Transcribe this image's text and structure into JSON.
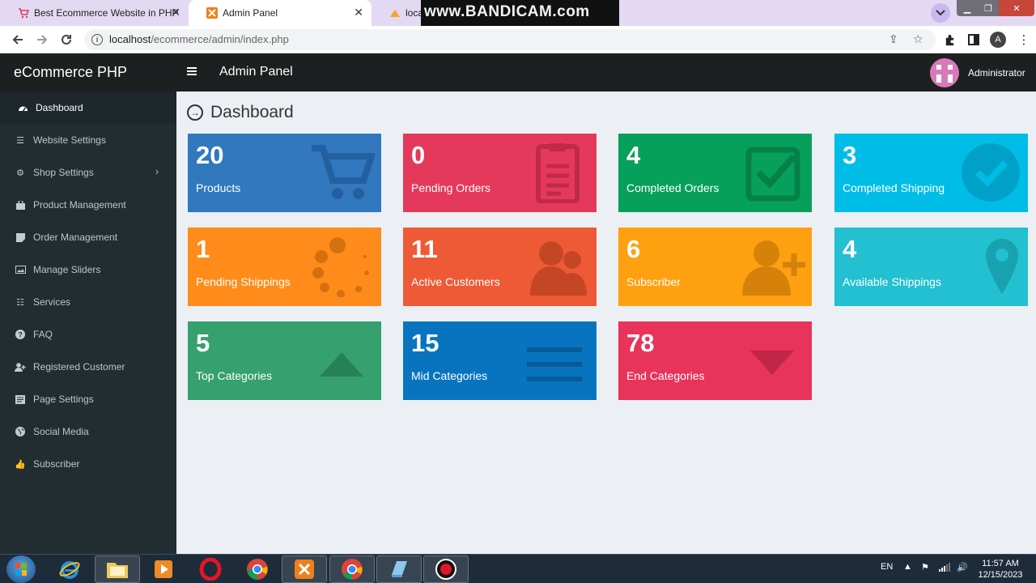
{
  "browser": {
    "tabs": [
      {
        "title": "Best Ecommerce Website in PHP",
        "active": false
      },
      {
        "title": "Admin Panel",
        "active": true
      },
      {
        "title": "localh",
        "active": false
      }
    ],
    "url_host": "localhost",
    "url_path": "/ecommerce/admin/index.php",
    "profile_initial": "A",
    "watermark": "www.BANDICAM.com"
  },
  "header": {
    "brand": "eCommerce PHP",
    "title": "Admin Panel",
    "user": "Administrator"
  },
  "sidebar": {
    "items": [
      {
        "label": "Dashboard",
        "icon": "dashboard-icon",
        "active": true
      },
      {
        "label": "Website Settings",
        "icon": "sliders-icon"
      },
      {
        "label": "Shop Settings",
        "icon": "cogs-icon",
        "has_submenu": true
      },
      {
        "label": "Product Management",
        "icon": "shopping-bag-icon"
      },
      {
        "label": "Order Management",
        "icon": "sticky-note-icon"
      },
      {
        "label": "Manage Sliders",
        "icon": "image-icon"
      },
      {
        "label": "Services",
        "icon": "list-icon"
      },
      {
        "label": "FAQ",
        "icon": "question-circle-icon"
      },
      {
        "label": "Registered Customer",
        "icon": "user-plus-icon"
      },
      {
        "label": "Page Settings",
        "icon": "file-icon"
      },
      {
        "label": "Social Media",
        "icon": "globe-icon"
      },
      {
        "label": "Subscriber",
        "icon": "thumbs-up-icon"
      }
    ]
  },
  "page": {
    "title": "Dashboard"
  },
  "cards": [
    {
      "value": "20",
      "label": "Products",
      "color": "#3178bf",
      "icon": "cart-icon"
    },
    {
      "value": "0",
      "label": "Pending Orders",
      "color": "#e5395b",
      "icon": "clipboard-icon"
    },
    {
      "value": "4",
      "label": "Completed Orders",
      "color": "#07a05a",
      "icon": "check-square-icon"
    },
    {
      "value": "3",
      "label": "Completed Shipping",
      "color": "#00bde8",
      "icon": "check-circle-icon"
    },
    {
      "value": "1",
      "label": "Pending Shippings",
      "color": "#ff8c1a",
      "icon": "spinner-icon"
    },
    {
      "value": "11",
      "label": "Active Customers",
      "color": "#ef5a36",
      "icon": "users-icon"
    },
    {
      "value": "6",
      "label": "Subscriber",
      "color": "#ffa010",
      "icon": "user-plus-icon"
    },
    {
      "value": "4",
      "label": "Available Shippings",
      "color": "#22c0d0",
      "icon": "map-marker-icon"
    },
    {
      "value": "5",
      "label": "Top Categories",
      "color": "#36a06e",
      "icon": "caret-up-icon"
    },
    {
      "value": "15",
      "label": "Mid Categories",
      "color": "#0874c0",
      "icon": "bars-icon"
    },
    {
      "value": "78",
      "label": "End Categories",
      "color": "#e8335a",
      "icon": "caret-down-icon"
    }
  ],
  "taskbar": {
    "lang": "EN",
    "time": "11:57 AM",
    "date": "12/15/2023"
  }
}
